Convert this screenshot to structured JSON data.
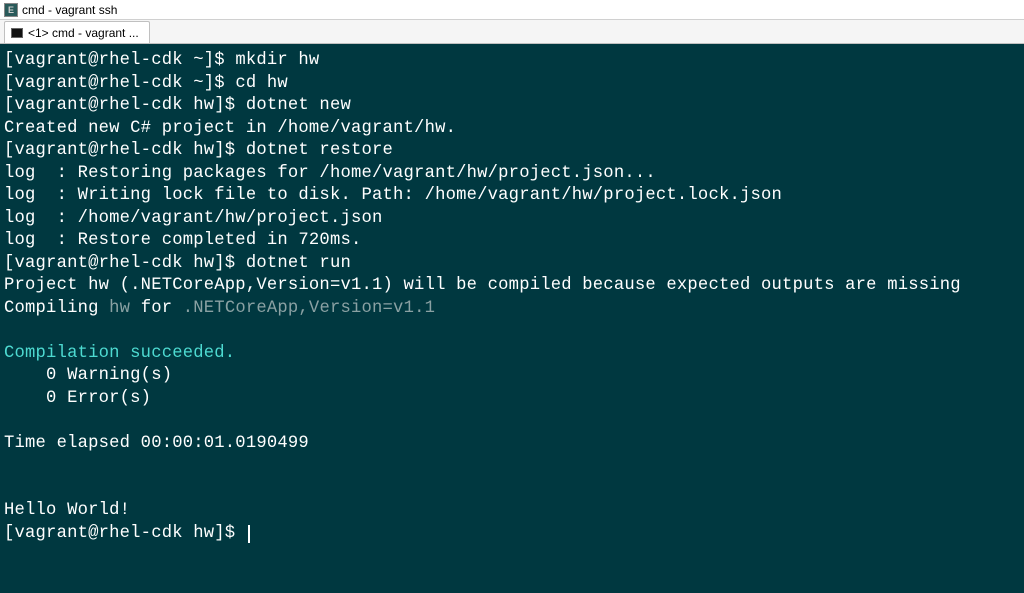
{
  "window": {
    "title": "cmd - vagrant  ssh",
    "icon_label": "E"
  },
  "tab": {
    "label": "<1>  cmd - vagrant  ..."
  },
  "term": {
    "p1": "[vagrant@rhel-cdk ~]$ ",
    "c1": "mkdir hw",
    "p2": "[vagrant@rhel-cdk ~]$ ",
    "c2": "cd hw",
    "p3": "[vagrant@rhel-cdk hw]$ ",
    "c3": "dotnet new",
    "l4": "Created new C# project in /home/vagrant/hw.",
    "p5": "[vagrant@rhel-cdk hw]$ ",
    "c5": "dotnet restore",
    "l6": "log  : Restoring packages for /home/vagrant/hw/project.json...",
    "l7": "log  : Writing lock file to disk. Path: /home/vagrant/hw/project.lock.json",
    "l8": "log  : /home/vagrant/hw/project.json",
    "l9": "log  : Restore completed in 720ms.",
    "p10": "[vagrant@rhel-cdk hw]$ ",
    "c10": "dotnet run",
    "l11": "Project hw (.NETCoreApp,Version=v1.1) will be compiled because expected outputs are missing",
    "l12a": "Compiling ",
    "l12b": "hw",
    "l12c": " for ",
    "l12d": ".NETCoreApp,Version=v1.1",
    "l14": "Compilation succeeded.",
    "l15": "    0 Warning(s)",
    "l16": "    0 Error(s)",
    "l18": "Time elapsed 00:00:01.0190499",
    "l21": "Hello World!",
    "p22": "[vagrant@rhel-cdk hw]$ "
  }
}
